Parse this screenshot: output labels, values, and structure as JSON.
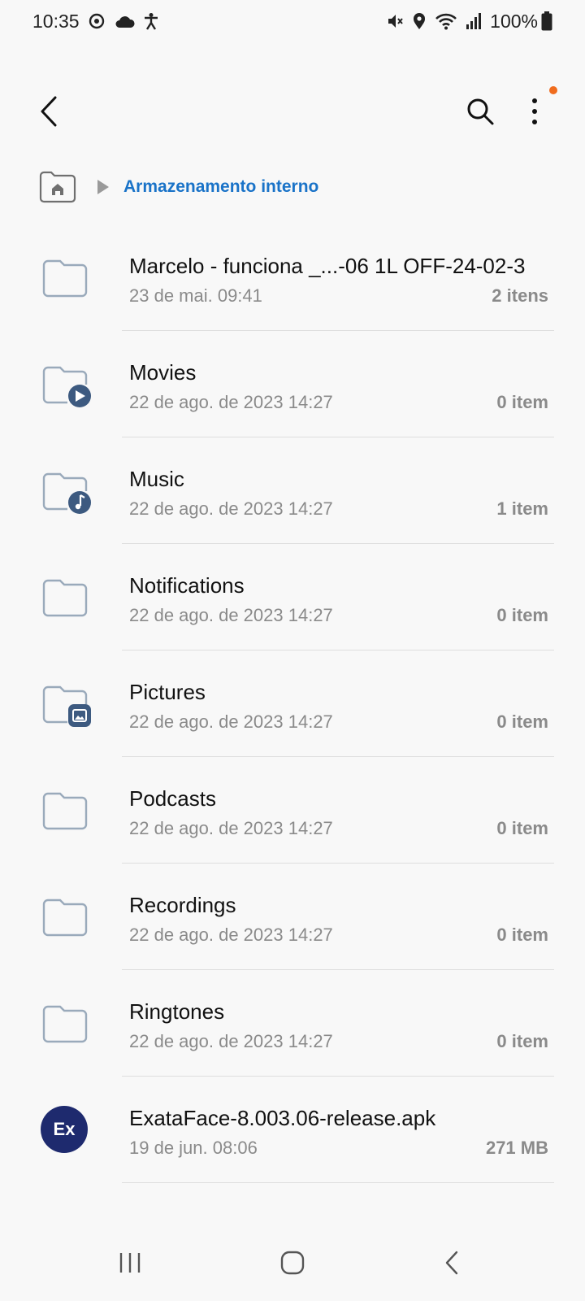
{
  "status_bar": {
    "time": "10:35",
    "battery_percent": "100%",
    "left_icons": [
      "sync-icon",
      "cloud-icon",
      "accessibility-icon"
    ],
    "right_icons": [
      "mute-icon",
      "location-icon",
      "wifi-icon",
      "signal-icon",
      "battery-icon"
    ]
  },
  "app_bar": {
    "icons": [
      "back-arrow-icon",
      "search-icon",
      "more-vert-icon"
    ],
    "notification_dot_color": "#f06c1e"
  },
  "breadcrumb": {
    "home_icon": "home-folder-icon",
    "current": "Armazenamento interno",
    "accent_color": "#1a73c8"
  },
  "files": [
    {
      "name": "Marcelo - funciona _...-06 1L OFF-24-02-3",
      "date": "23 de mai. 09:41",
      "count": "2 itens",
      "icon": "folder-icon"
    },
    {
      "name": "Movies",
      "date": "22 de ago. de 2023 14:27",
      "count": "0 item",
      "icon": "folder-video-icon"
    },
    {
      "name": "Music",
      "date": "22 de ago. de 2023 14:27",
      "count": "1 item",
      "icon": "folder-music-icon"
    },
    {
      "name": "Notifications",
      "date": "22 de ago. de 2023 14:27",
      "count": "0 item",
      "icon": "folder-icon"
    },
    {
      "name": "Pictures",
      "date": "22 de ago. de 2023 14:27",
      "count": "0 item",
      "icon": "folder-image-icon"
    },
    {
      "name": "Podcasts",
      "date": "22 de ago. de 2023 14:27",
      "count": "0 item",
      "icon": "folder-icon"
    },
    {
      "name": "Recordings",
      "date": "22 de ago. de 2023 14:27",
      "count": "0 item",
      "icon": "folder-icon"
    },
    {
      "name": "Ringtones",
      "date": "22 de ago. de 2023 14:27",
      "count": "0 item",
      "icon": "folder-icon"
    },
    {
      "name": "ExataFace-8.003.06-release.apk",
      "date": "19 de jun. 08:06",
      "count": "271 MB",
      "icon": "apk-icon",
      "icon_text": "Ex"
    }
  ],
  "nav_bar": {
    "icons": [
      "recent-apps-icon",
      "home-icon",
      "back-icon"
    ]
  }
}
